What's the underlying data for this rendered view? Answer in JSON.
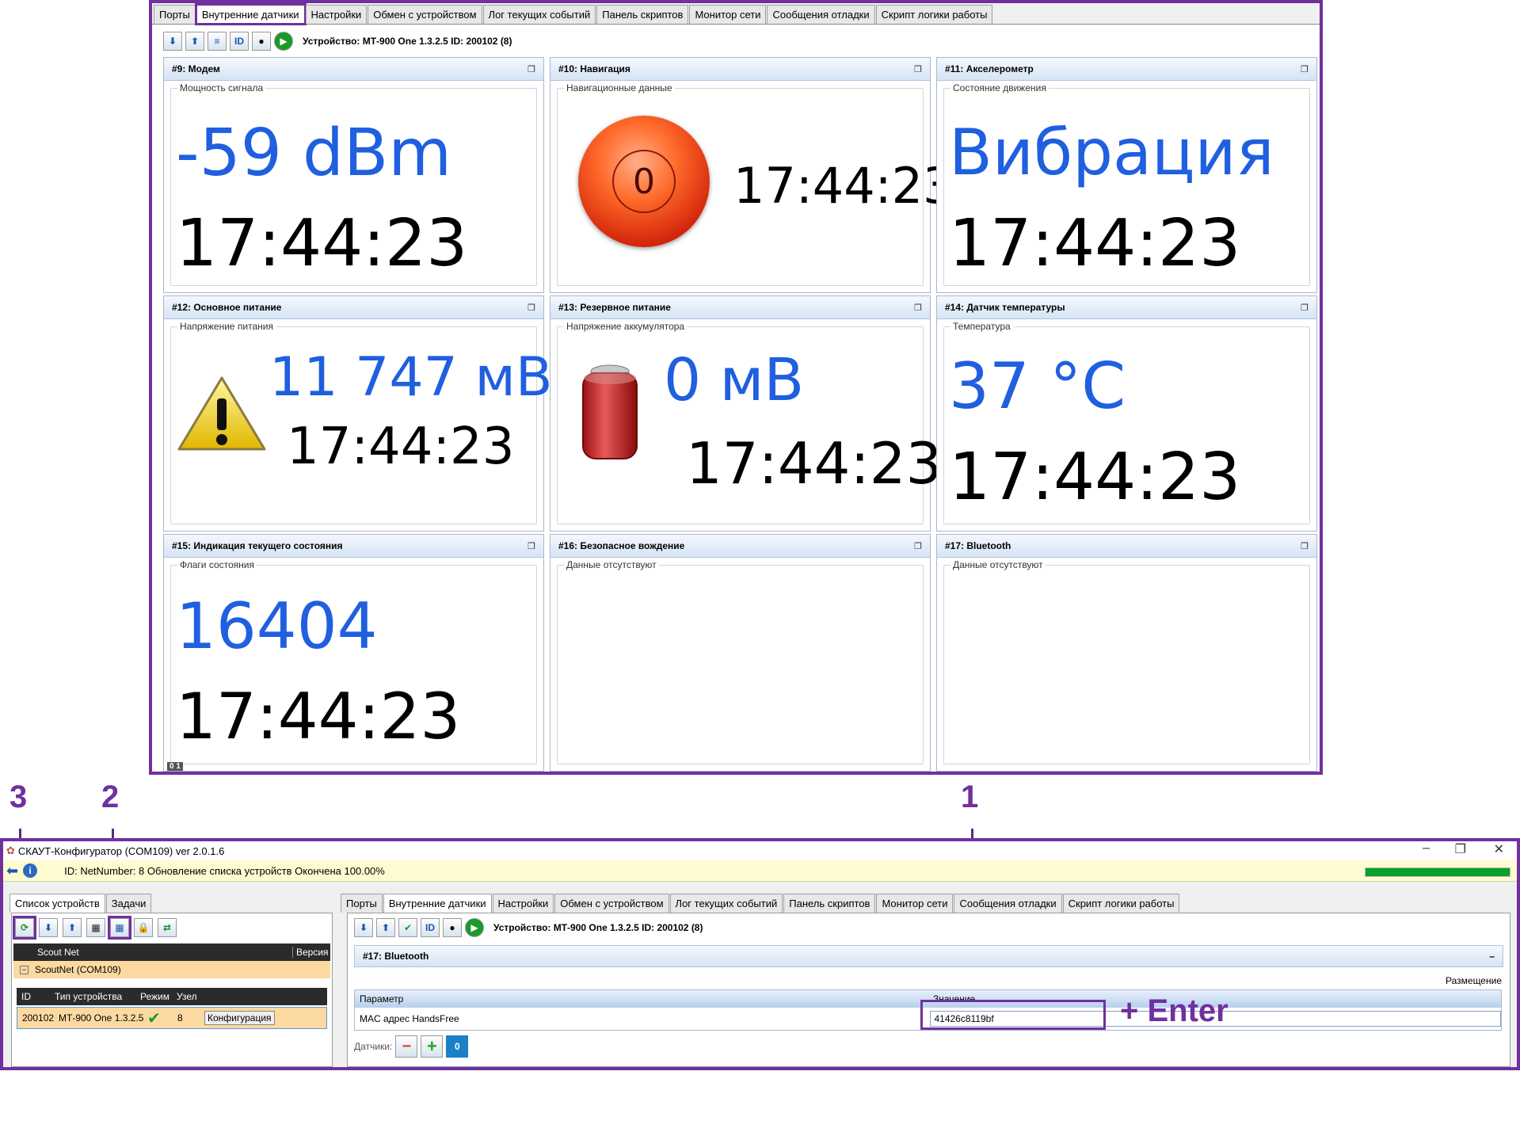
{
  "top": {
    "tabs": [
      "Порты",
      "Внутренние датчики",
      "Настройки",
      "Обмен с устройством",
      "Лог текущих событий",
      "Панель скриптов",
      "Монитор сети",
      "Сообщения отладки",
      "Скрипт логики работы"
    ],
    "toolbar_id_label": "ID",
    "device_label": "Устройство: МТ-900 One 1.3.2.5 ID: 200102 (8)",
    "panels": {
      "modem": {
        "title": "#9: Модем",
        "group": "Мощность сигнала",
        "value": "-59 dBm",
        "time": "17:44:23"
      },
      "nav": {
        "title": "#10: Навигация",
        "group": "Навигационные данные",
        "satellites": "0",
        "time": "17:44:23"
      },
      "accel": {
        "title": "#11: Акселерометр",
        "group": "Состояние движения",
        "value": "Вибрация",
        "time": "17:44:23"
      },
      "main_power": {
        "title": "#12: Основное питание",
        "group": "Напряжение питания",
        "value": "11 747 мВ",
        "time": "17:44:23"
      },
      "backup_power": {
        "title": "#13: Резервное питание",
        "group": "Напряжение аккумулятора",
        "value": "0 мВ",
        "time": "17:44:23"
      },
      "temp": {
        "title": "#14: Датчик температуры",
        "group": "Температура",
        "value": "37 °C",
        "time": "17:44:23"
      },
      "status": {
        "title": "#15:  Индикация текущего состояния",
        "group": "Флаги состояния",
        "value": "16404",
        "time": "17:44:23"
      },
      "safe_driving": {
        "title": "#16: Безопасное вождение",
        "group": "Данные отсутствуют"
      },
      "bluetooth": {
        "title": "#17: Bluetooth",
        "group": "Данные отсутствуют"
      }
    },
    "page_badge": "0 1"
  },
  "annotations": {
    "n3": "3",
    "n2": "2",
    "n1": "1",
    "enter": "+ Enter"
  },
  "bottom": {
    "title": "СКАУТ-Конфигуратор (COM109) ver 2.0.1.6",
    "status": "ID:  NetNumber: 8 Обновление списка устройств Окончена 100.00%",
    "progress": 1.0,
    "left_tabs": [
      "Список устройств",
      "Задачи"
    ],
    "tree_headers": [
      "Scout Net",
      "Версия"
    ],
    "tree_node": "ScoutNet (COM109)",
    "dev_headers": [
      "ID",
      "Тип устройства",
      "Режим",
      "Узел"
    ],
    "dev_row": {
      "id": "200102",
      "type": "МТ-900 One 1.3.2.5",
      "node": "8",
      "action": "Конфигурация"
    },
    "right_tabs": [
      "Порты",
      "Внутренние датчики",
      "Настройки",
      "Обмен с устройством",
      "Лог текущих событий",
      "Панель скриптов",
      "Монитор сети",
      "Сообщения отладки",
      "Скрипт логики работы"
    ],
    "device_label": "Устройство: МТ-900 One 1.3.2.5 ID: 200102 (8)",
    "toolbar_id_label": "ID",
    "section_title": "#17: Bluetooth",
    "placement_label": "Размещение",
    "table_headers": [
      "Параметр",
      "Значение"
    ],
    "row_param": "MAC адрес HandsFree",
    "row_value": "41426c8119bf",
    "sensors_label": "Датчики:",
    "sensors_count": "0"
  },
  "colors": {
    "accent": "#7030a0",
    "value_blue": "#1f5fe0",
    "progress": "#0aa02a"
  }
}
